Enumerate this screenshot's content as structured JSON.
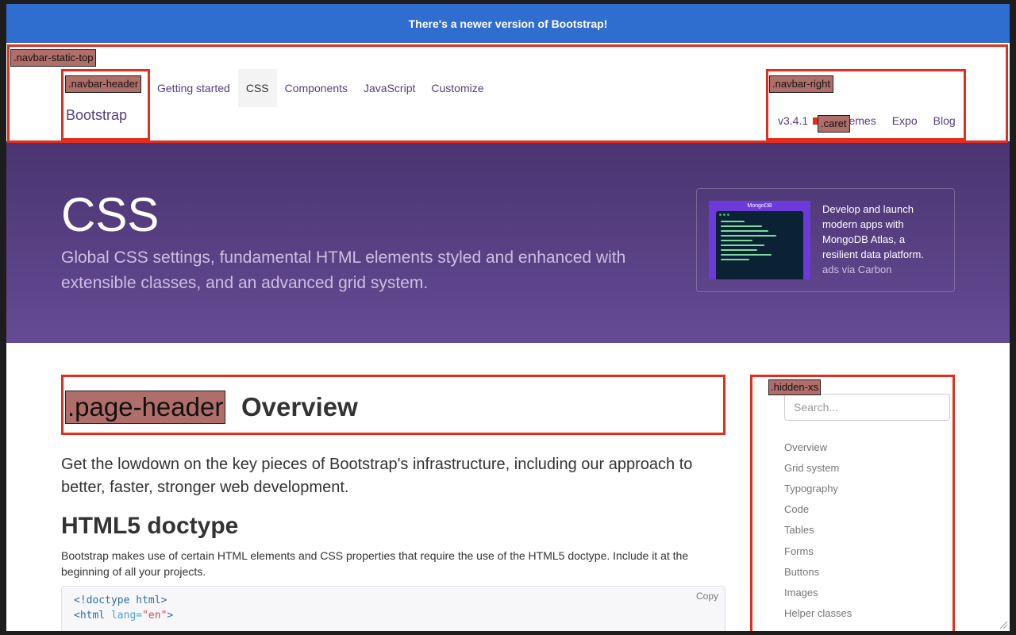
{
  "banner": {
    "text": "There's a newer version of Bootstrap!"
  },
  "navbar": {
    "brand": "Bootstrap",
    "links": [
      "Getting started",
      "CSS",
      "Components",
      "JavaScript",
      "Customize"
    ],
    "active": "CSS",
    "right": {
      "version": "v3.4.1",
      "links": [
        "Themes",
        "Expo",
        "Blog"
      ]
    }
  },
  "hero": {
    "title": "CSS",
    "subtitle": "Global CSS settings, fundamental HTML elements styled and enhanced with extensible classes, and an advanced grid system."
  },
  "ad": {
    "logo": "MongoDB",
    "text": "Develop and launch modern apps with MongoDB Atlas, a resilient data platform.",
    "via": "ads via Carbon"
  },
  "content": {
    "page_title": "Overview",
    "lead": "Get the lowdown on the key pieces of Bootstrap's infrastructure, including our approach to better, faster, stronger web development.",
    "section_title": "HTML5 doctype",
    "paragraph": "Bootstrap makes use of certain HTML elements and CSS properties that require the use of the HTML5 doctype. Include it at the beginning of all your projects.",
    "code": {
      "line1": "<!doctype html>",
      "line2_tag": "<html ",
      "line2_attr": "lang=",
      "line2_val": "\"en\"",
      "line2_end": ">",
      "copy": "Copy"
    }
  },
  "sidebar": {
    "search_placeholder": "Search...",
    "items": [
      "Overview",
      "Grid system",
      "Typography",
      "Code",
      "Tables",
      "Forms",
      "Buttons",
      "Images",
      "Helper classes"
    ]
  },
  "annotations": {
    "navbar_static_top": ".navbar-static-top",
    "navbar_header": ".navbar-header",
    "navbar_right": ".navbar-right",
    "caret": ".caret",
    "page_header": ".page-header",
    "hidden_xs": ".hidden-xs"
  },
  "colors": {
    "banner": "#2f6ecf",
    "brand_purple": "#563d7c",
    "hero_top": "#4a3470",
    "hero_bottom": "#654b94",
    "highlight_border": "#e32e1c",
    "tag_bg": "#b06e6a"
  }
}
